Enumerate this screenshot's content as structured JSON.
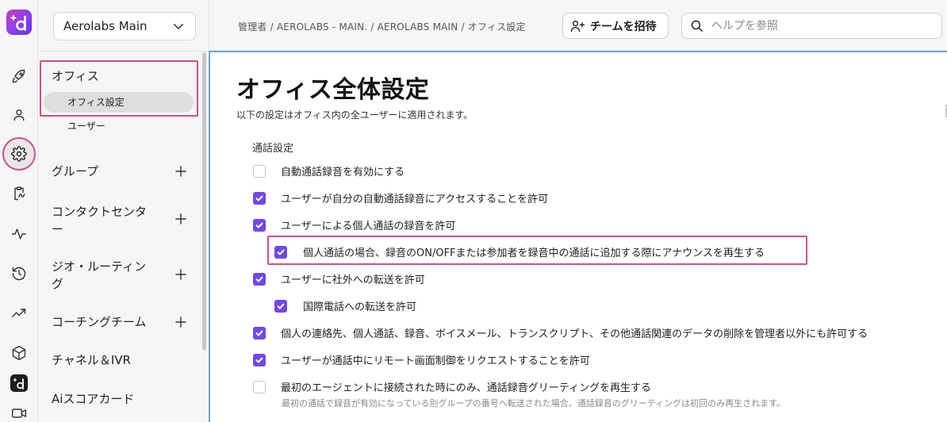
{
  "app": {
    "workspace_name": "Aerolabs Main"
  },
  "rail": {
    "icons": [
      "rocket-icon",
      "person-icon",
      "gear-icon",
      "clipboard-icon",
      "activity-icon",
      "history-icon",
      "trending-icon",
      "box-icon",
      "brand-d-icon",
      "video-icon"
    ]
  },
  "sidebar": {
    "sections": [
      {
        "label": "オフィス",
        "items": [
          {
            "label": "オフィス設定",
            "selected": true
          },
          {
            "label": "ユーザー"
          }
        ]
      },
      {
        "label": "グループ",
        "expandable": true
      },
      {
        "label": "コンタクトセンター",
        "expandable": true
      },
      {
        "label": "ジオ・ルーティング",
        "expandable": true
      },
      {
        "label": "コーチングチーム",
        "expandable": true
      },
      {
        "label": "チャネル＆IVR"
      },
      {
        "label": "Aiスコアカード"
      }
    ]
  },
  "header": {
    "breadcrumb": "管理者 / AEROLABS - MAIN. / AEROLABS MAIN / オフィス設定",
    "invite_label": "チームを招待",
    "search_placeholder": "ヘルプを参照"
  },
  "main": {
    "title": "オフィス全体設定",
    "description": "以下の設定はオフィス内の全ユーザーに適用されます。",
    "section_title": "通話設定",
    "settings": [
      {
        "label": "自動通話録音を有効にする",
        "checked": false
      },
      {
        "label": "ユーザーが自分の自動通話録音にアクセスすることを許可",
        "checked": true
      },
      {
        "label": "ユーザーによる個人通話の録音を許可",
        "checked": true
      },
      {
        "label": "個人通話の場合、録音のON/OFFまたは参加者を録音中の通話に追加する際にアナウンスを再生する",
        "checked": true
      },
      {
        "label": "ユーザーに社外への転送を許可",
        "checked": true
      },
      {
        "label": "国際電話への転送を許可",
        "checked": true
      },
      {
        "label": "個人の連絡先、個人通話、録音、ボイスメール、トランスクリプト、その他通話関連のデータの削除を管理者以外にも許可する",
        "checked": true
      },
      {
        "label": "ユーザーが通話中にリモート画面制御をリクエストすることを許可",
        "checked": true
      },
      {
        "label": "最初のエージェントに接続された時にのみ、通話録音グリーティングを再生する",
        "checked": false
      }
    ],
    "last_setting_note": "最初の通話で録音が有効になっている別グループの番号へ転送された場合、通話録音のグリーティングは初回のみ再生されます。"
  },
  "colors": {
    "accent": "#7048e8",
    "highlight": "#cf4f85",
    "focus_border": "#6da6d8"
  }
}
